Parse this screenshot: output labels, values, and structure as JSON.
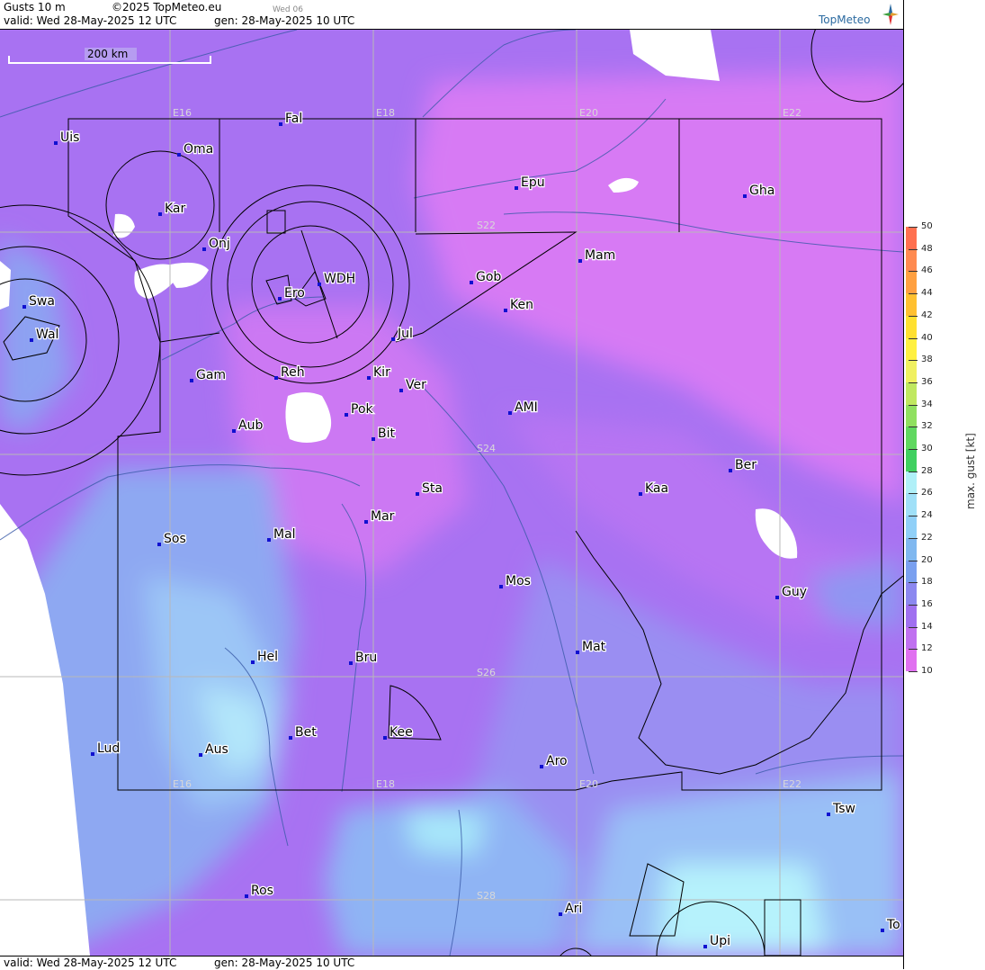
{
  "header": {
    "product": "Gusts 10 m",
    "copyright": "©2025 TopMeteo.eu",
    "day_tag": "Wed 06",
    "valid": "valid:  Wed  28-May-2025  12 UTC",
    "gen": "gen: 28-May-2025 10 UTC",
    "brand": "TopMeteo"
  },
  "footer": {
    "valid": "valid:  Wed  28-May-2025  12 UTC",
    "gen": "gen: 28-May-2025 10 UTC"
  },
  "scale_bar": "200 km",
  "grid_labels": {
    "lon": [
      "E16",
      "E18",
      "E20",
      "E22"
    ],
    "lat": [
      "S22",
      "S24",
      "S26",
      "S28"
    ]
  },
  "places": [
    "Uis",
    "Fal",
    "Oma",
    "Kar",
    "Onj",
    "Epu",
    "Gha",
    "Swa",
    "Wal",
    "WDH",
    "Ero",
    "Gob",
    "Mam",
    "Ken",
    "Jul",
    "Gam",
    "Reh",
    "Kir",
    "Ver",
    "Pok",
    "AMI",
    "Bit",
    "Aub",
    "Ber",
    "Sta",
    "Kaa",
    "Sos",
    "Mal",
    "Mar",
    "Mos",
    "Guy",
    "Mat",
    "Hel",
    "Bru",
    "Bet",
    "Kee",
    "Lud",
    "Aus",
    "Aro",
    "Tsw",
    "Ros",
    "Ari",
    "Upi",
    "To"
  ],
  "legend": {
    "title": "max. gust [kt]",
    "ticks": [
      "50",
      "48",
      "46",
      "44",
      "42",
      "40",
      "38",
      "36",
      "34",
      "32",
      "30",
      "28",
      "26",
      "24",
      "22",
      "20",
      "18",
      "16",
      "14",
      "12",
      "10"
    ],
    "colors": [
      "#ff7050",
      "#ff8a50",
      "#ffa040",
      "#ffc030",
      "#ffe030",
      "#fff040",
      "#f0f060",
      "#c0e860",
      "#90e060",
      "#60d860",
      "#40d060",
      "#b0f0f8",
      "#a0e0f8",
      "#90d0f8",
      "#80b8f0",
      "#7aa0f0",
      "#8c88f0",
      "#a070f0",
      "#c070f0",
      "#e070f0"
    ]
  }
}
